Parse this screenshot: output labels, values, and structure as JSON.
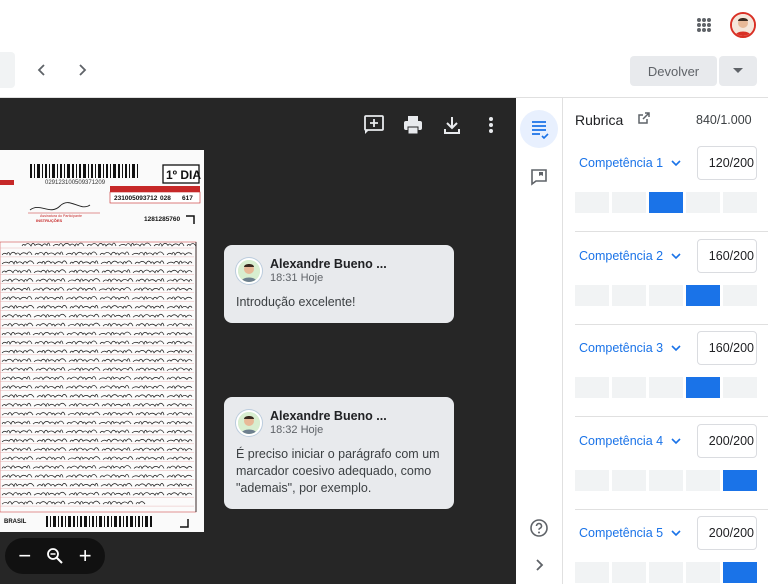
{
  "toolbar": {
    "return_label": "Devolver"
  },
  "rubric": {
    "title": "Rubrica",
    "total_score": "840",
    "total_max": "/1.000",
    "criteria": [
      {
        "label": "Competência 1",
        "score": "120",
        "max": "/200",
        "selected_level": 3,
        "levels": 5
      },
      {
        "label": "Competência 2",
        "score": "160",
        "max": "/200",
        "selected_level": 4,
        "levels": 5
      },
      {
        "label": "Competência 3",
        "score": "160",
        "max": "/200",
        "selected_level": 4,
        "levels": 5
      },
      {
        "label": "Competência 4",
        "score": "200",
        "max": "/200",
        "selected_level": 5,
        "levels": 5
      },
      {
        "label": "Competência 5",
        "score": "200",
        "max": "/200",
        "selected_level": 5,
        "levels": 5
      }
    ]
  },
  "comments": [
    {
      "author": "Alexandre Bueno ...",
      "time": "18:31 Hoje",
      "text": "Introdução excelente!"
    },
    {
      "author": "Alexandre Bueno ...",
      "time": "18:32 Hoje",
      "text": "É preciso iniciar o parágrafo com um marcador coesivo adequado, como \"ademais\", por exemplo."
    }
  ],
  "document": {
    "day_label": "1º DIA",
    "barcode_number": "029123100509371209",
    "inscription": "231005093712",
    "seq": "028",
    "room": "617",
    "form_no": "1281285760",
    "signature_label": "Assinatura do Participante",
    "instructions_title": "INSTRUÇÕES",
    "footer_brand": "BRASIL"
  },
  "zoom": {
    "out": "−",
    "in": "+"
  },
  "colors": {
    "accent": "#1a73e8",
    "viewer_bg": "#262626"
  }
}
